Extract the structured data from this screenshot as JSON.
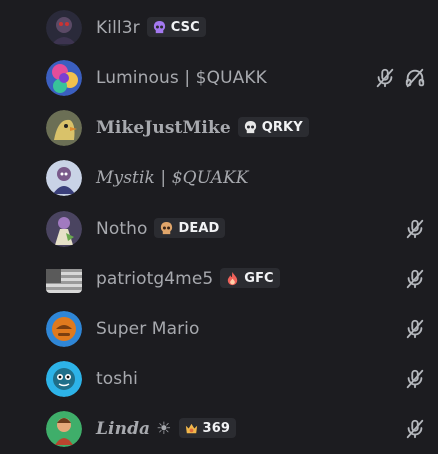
{
  "members": [
    {
      "name": "Kill3r",
      "avatar": "dark-avatar-icon",
      "tag": {
        "label": "CSC",
        "icon": "skull-purple-icon"
      },
      "muted": false,
      "deafened": false
    },
    {
      "name": "Luminous | $QUAKK",
      "avatar": "colorful-avatar-icon",
      "tag": null,
      "muted": true,
      "deafened": true
    },
    {
      "name": "MikeJustMike",
      "avatar": "eagle-avatar-icon",
      "tag": {
        "label": "QRKY",
        "icon": "skull-icon"
      },
      "muted": false,
      "deafened": false
    },
    {
      "name": "Mystik | $QUAKK",
      "avatar": "character-avatar-icon",
      "tag": null,
      "muted": false,
      "deafened": false
    },
    {
      "name": "Notho",
      "avatar": "figure-avatar-icon",
      "tag": {
        "label": "DEAD",
        "icon": "skull-orange-icon"
      },
      "muted": true,
      "deafened": false
    },
    {
      "name": "patriotg4me5",
      "avatar": "flag-avatar-icon",
      "tag": {
        "label": "GFC",
        "icon": "flame-icon"
      },
      "muted": true,
      "deafened": false
    },
    {
      "name": "Super Mario",
      "avatar": "orange-avatar-icon",
      "tag": null,
      "muted": true,
      "deafened": false
    },
    {
      "name": "toshi",
      "avatar": "teal-avatar-icon",
      "tag": null,
      "muted": true,
      "deafened": false
    },
    {
      "name": "Linda ☀",
      "avatar": "green-avatar-icon",
      "tag": {
        "label": "369",
        "icon": "crown-icon"
      },
      "muted": true,
      "deafened": false
    }
  ],
  "colors": {
    "background": "#1c1c20",
    "name": "#a7a9ae",
    "tag_bg": "#2b2c31",
    "icon": "#b5b8bd"
  }
}
